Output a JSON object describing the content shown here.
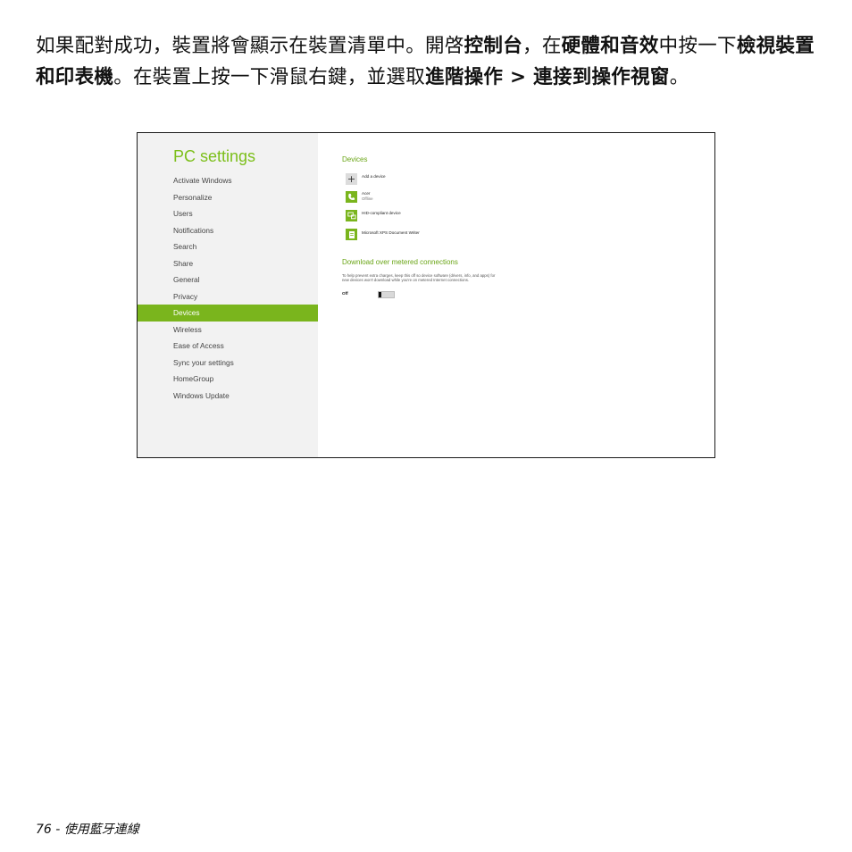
{
  "instruction": {
    "p1": "如果配對成功，裝置將會顯示在裝置清單中。開啓",
    "b1": "控制台",
    "p2": "，在",
    "b2": "硬體和音效",
    "p3": "中按一下",
    "b3": "檢視裝置和印表機",
    "p4": "。在裝置上按一下滑鼠右鍵，並選取",
    "b4": "進階操作 > 連接到操作視窗",
    "p5": "。"
  },
  "screenshot": {
    "title": "PC settings",
    "nav": [
      {
        "label": "Activate Windows",
        "active": false
      },
      {
        "label": "Personalize",
        "active": false
      },
      {
        "label": "Users",
        "active": false
      },
      {
        "label": "Notifications",
        "active": false
      },
      {
        "label": "Search",
        "active": false
      },
      {
        "label": "Share",
        "active": false
      },
      {
        "label": "General",
        "active": false
      },
      {
        "label": "Privacy",
        "active": false
      },
      {
        "label": "Devices",
        "active": true
      },
      {
        "label": "Wireless",
        "active": false
      },
      {
        "label": "Ease of Access",
        "active": false
      },
      {
        "label": "Sync your settings",
        "active": false
      },
      {
        "label": "HomeGroup",
        "active": false
      },
      {
        "label": "Windows Update",
        "active": false
      }
    ],
    "devices_title": "Devices",
    "devices": [
      {
        "name": "Add a device",
        "status": "",
        "icon": "plus-icon"
      },
      {
        "name": "Acer",
        "status": "Offline",
        "icon": "phone-icon"
      },
      {
        "name": "HID-compliant device",
        "status": "",
        "icon": "keyboard-device-icon"
      },
      {
        "name": "Microsoft XPS Document Writer",
        "status": "",
        "icon": "printer-document-icon"
      }
    ],
    "metered_title": "Download over metered connections",
    "metered_desc": "To help prevent extra charges, keep this off so device software (drivers, info, and apps) for new devices won't download while you're on metered Internet connections.",
    "toggle_label": "Off",
    "accent": "#7ab51d",
    "title_color": "#7cbf1a"
  },
  "footer": {
    "page": "76",
    "sep": " - ",
    "section": "使用藍牙連線"
  }
}
